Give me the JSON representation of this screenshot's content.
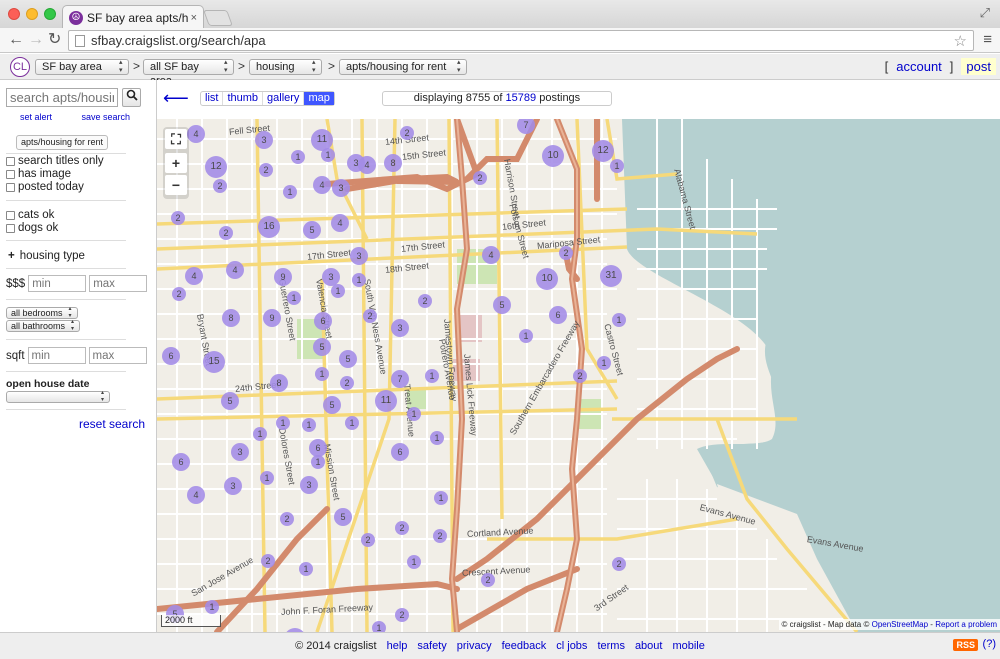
{
  "browser": {
    "tab_title": "SF bay area apts/housing f",
    "tab_close": "×",
    "favicon": "☮",
    "url": "sfbay.craigslist.org/search/apa",
    "back": "←",
    "forward": "→",
    "reload": "C",
    "star": "☆",
    "menu": "≡"
  },
  "header": {
    "logo": "CL",
    "area": "SF bay area",
    "subarea": "all SF bay area",
    "category": "housing",
    "subcategory": "apts/housing for rent",
    "sep": ">",
    "bracket_open": "[",
    "account": "account",
    "bracket_close": "]",
    "post": "post"
  },
  "sidebar": {
    "search_placeholder": "search apts/housing",
    "search_icon": "magnifier-icon",
    "set_alert": "set alert",
    "save_search": "save search",
    "category_button": "apts/housing for rent",
    "checkboxes_top": [
      "search titles only",
      "has image",
      "posted today"
    ],
    "checkboxes_pets": [
      "cats ok",
      "dogs ok"
    ],
    "housing_type_plus": "+",
    "housing_type": "housing type",
    "price_label": "$$$",
    "min_placeholder": "min",
    "max_placeholder": "max",
    "bedrooms": "all bedrooms",
    "bathrooms": "all bathrooms",
    "sqft_label": "sqft",
    "open_house_label": "open house date",
    "reset": "reset search"
  },
  "main": {
    "back_arrow": "⟵",
    "view_tabs": [
      "list",
      "thumb",
      "gallery",
      "map"
    ],
    "active_view": "map",
    "displaying_prefix": "displaying 8755 of",
    "displaying_total": "15789",
    "displaying_suffix": "postings"
  },
  "map": {
    "controls": {
      "fullscreen": "⛶",
      "zoom_in": "+",
      "zoom_out": "−"
    },
    "scale": "2000 ft",
    "attribution_prefix": "© craigslist - Map data ©",
    "attribution_osm": "OpenStreetMap",
    "attribution_sep": " - ",
    "attribution_report": "Report a problem",
    "marker_color": "#a38ce8",
    "street_labels": [
      "Fell Street",
      "14th Street",
      "15th Street",
      "16th Street",
      "17th Street",
      "Mariposa Street",
      "17th Street",
      "18th Street",
      "24th Street",
      "Cortland Avenue",
      "Crescent Avenue",
      "Evans Avenue",
      "Evans Avenue",
      "John F. Foran Freeway",
      "San Jose Avenue",
      "Dolores Street",
      "Guerrero Street",
      "Mission Street",
      "Valencia Street",
      "South Van Ness Avenue",
      "Potrero Avenue",
      "Jamestown Freeway",
      "James Lick Freeway",
      "Southern Embarcadero Freeway",
      "3rd Street",
      "Castro Street",
      "Bryant Street",
      "Alabama Street",
      "Harrison Street",
      "Folsom Street",
      "Treat Avenue"
    ],
    "markers": [
      {
        "n": "4"
      },
      {
        "n": "3"
      },
      {
        "n": "11"
      },
      {
        "n": "2"
      },
      {
        "n": "1"
      },
      {
        "n": "3"
      },
      {
        "n": "10"
      },
      {
        "n": "12"
      },
      {
        "n": "12"
      },
      {
        "n": "2"
      },
      {
        "n": "1"
      },
      {
        "n": "4"
      },
      {
        "n": "8"
      },
      {
        "n": "2"
      },
      {
        "n": "1"
      },
      {
        "n": "2"
      },
      {
        "n": "4"
      },
      {
        "n": "3"
      },
      {
        "n": "1"
      },
      {
        "n": "2"
      },
      {
        "n": "2"
      },
      {
        "n": "16"
      },
      {
        "n": "5"
      },
      {
        "n": "4"
      },
      {
        "n": "7"
      },
      {
        "n": "3"
      },
      {
        "n": "4"
      },
      {
        "n": "4"
      },
      {
        "n": "9"
      },
      {
        "n": "3"
      },
      {
        "n": "2"
      },
      {
        "n": "1"
      },
      {
        "n": "10"
      },
      {
        "n": "31"
      },
      {
        "n": "4"
      },
      {
        "n": "2"
      },
      {
        "n": "1"
      },
      {
        "n": "1"
      },
      {
        "n": "2"
      },
      {
        "n": "5"
      },
      {
        "n": "8"
      },
      {
        "n": "9"
      },
      {
        "n": "6"
      },
      {
        "n": "2"
      },
      {
        "n": "3"
      },
      {
        "n": "6"
      },
      {
        "n": "1"
      },
      {
        "n": "6"
      },
      {
        "n": "15"
      },
      {
        "n": "5"
      },
      {
        "n": "5"
      },
      {
        "n": "1"
      },
      {
        "n": "1"
      },
      {
        "n": "7"
      },
      {
        "n": "8"
      },
      {
        "n": "2"
      },
      {
        "n": "1"
      },
      {
        "n": "1"
      },
      {
        "n": "2"
      },
      {
        "n": "1"
      },
      {
        "n": "5"
      },
      {
        "n": "5"
      },
      {
        "n": "11"
      },
      {
        "n": "1"
      },
      {
        "n": "1"
      },
      {
        "n": "1"
      },
      {
        "n": "1"
      },
      {
        "n": "1"
      },
      {
        "n": "6"
      },
      {
        "n": "3"
      },
      {
        "n": "6"
      },
      {
        "n": "6"
      },
      {
        "n": "1"
      },
      {
        "n": "3"
      },
      {
        "n": "1"
      },
      {
        "n": "3"
      },
      {
        "n": "4"
      },
      {
        "n": "1"
      },
      {
        "n": "2"
      },
      {
        "n": "5"
      },
      {
        "n": "2"
      },
      {
        "n": "2"
      },
      {
        "n": "2"
      },
      {
        "n": "2"
      },
      {
        "n": "1"
      },
      {
        "n": "1"
      },
      {
        "n": "2"
      },
      {
        "n": "2"
      },
      {
        "n": "5"
      },
      {
        "n": "1"
      },
      {
        "n": "11"
      },
      {
        "n": "1"
      },
      {
        "n": "2"
      }
    ]
  },
  "footer": {
    "copyright": "© 2014 craigslist",
    "links": [
      "help",
      "safety",
      "privacy",
      "feedback",
      "cl jobs",
      "terms",
      "about",
      "mobile"
    ],
    "rss": "RSS",
    "help_q": "(?)"
  }
}
